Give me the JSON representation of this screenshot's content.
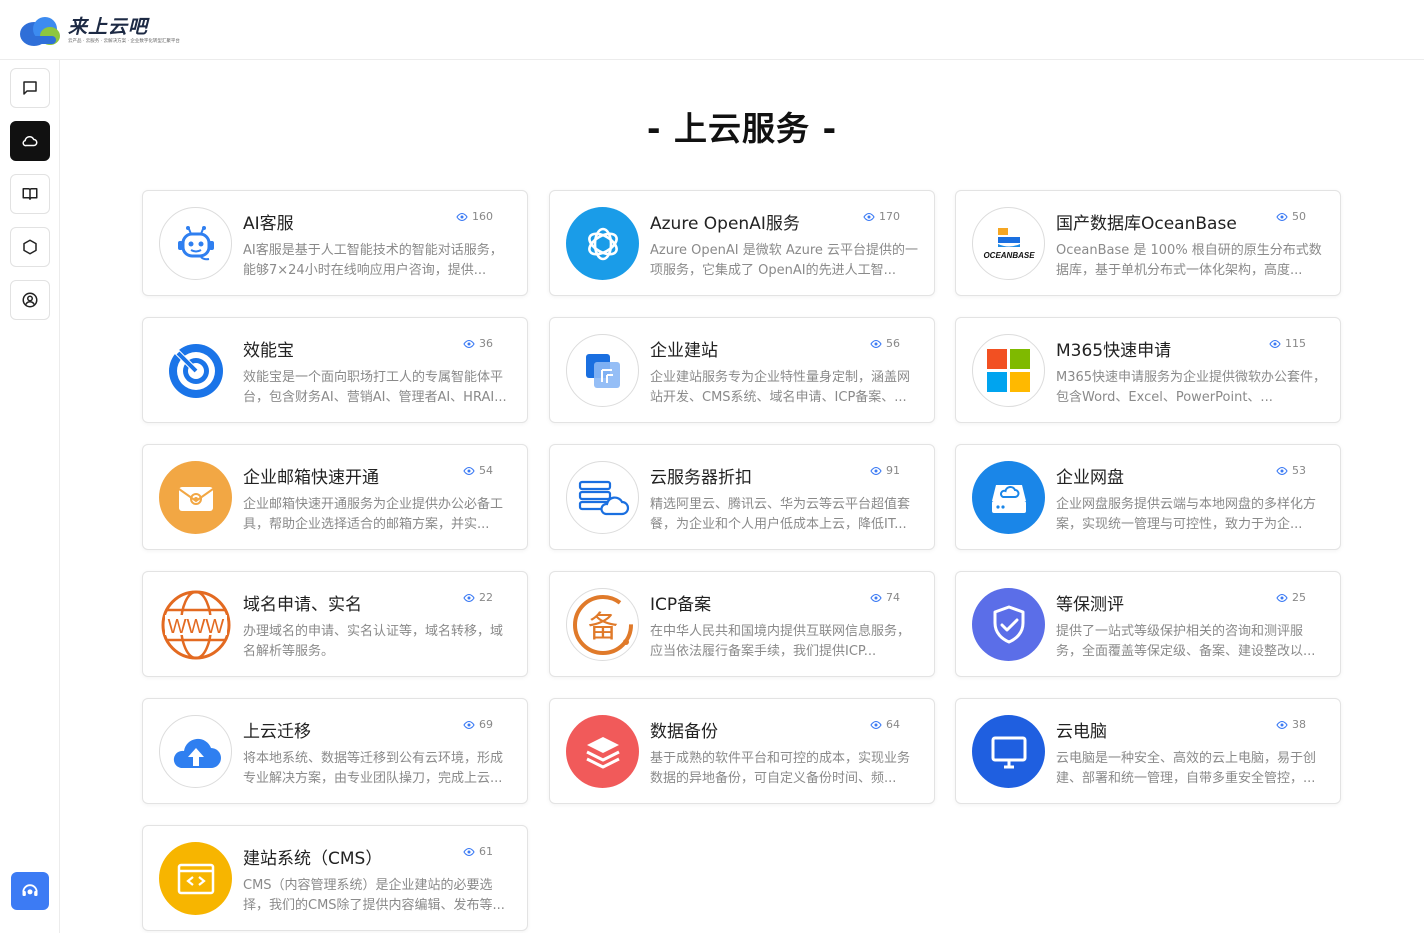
{
  "brand": {
    "title": "来上云吧",
    "subtitle": "云产品 · 云服务 · 云解决方案 · 企业数字化转型汇聚平台",
    "icon": "cloud-logo-icon"
  },
  "sidebar": {
    "items": [
      {
        "icon": "chat-icon",
        "active": false
      },
      {
        "icon": "cloud-icon",
        "active": true
      },
      {
        "icon": "book-icon",
        "active": false
      },
      {
        "icon": "hexagon-icon",
        "active": false
      },
      {
        "icon": "user-circle-icon",
        "active": false
      }
    ],
    "support_icon": "customer-service-icon"
  },
  "page": {
    "title": "- 上云服务 -"
  },
  "colors": {
    "accent": "#3c7bf4",
    "active_nav": "#111111"
  },
  "services": [
    {
      "title": "AI客服",
      "views": "160",
      "desc": "AI客服是基于人工智能技术的智能对话服务，能够7×24小时在线响应用户咨询，提供...",
      "icon": "robot-icon"
    },
    {
      "title": "Azure OpenAI服务",
      "views": "170",
      "desc": "Azure OpenAI 是微软 Azure 云平台提供的一项服务，它集成了 OpenAI的先进人工智...",
      "icon": "openai-icon"
    },
    {
      "title": "国产数据库OceanBase",
      "views": "50",
      "desc": "OceanBase 是 100% 根自研的原生分布式数据库，基于单机分布式一体化架构，高度...",
      "icon": "oceanbase-logo-icon",
      "logo_text": "OCEANBASE"
    },
    {
      "title": "效能宝",
      "views": "36",
      "desc": "效能宝是一个面向职场打工人的专属智能体平台，包含财务AI、营销AI、管理者AI、HRAI...",
      "icon": "gauge-icon"
    },
    {
      "title": "企业建站",
      "views": "56",
      "desc": "企业建站服务专为企业特性量身定制，涵盖网站开发、CMS系统、域名申请、ICP备案、...",
      "icon": "website-builder-icon"
    },
    {
      "title": "M365快速申请",
      "views": "115",
      "desc": "M365快速申请服务为企业提供微软办公套件，包含Word、Excel、PowerPoint、...",
      "icon": "microsoft-logo-icon"
    },
    {
      "title": "企业邮箱快速开通",
      "views": "54",
      "desc": "企业邮箱快速开通服务为企业提供办公必备工具，帮助企业选择适合的邮箱方案，并实...",
      "icon": "email-icon"
    },
    {
      "title": "云服务器折扣",
      "views": "91",
      "desc": "精选阿里云、腾讯云、华为云等云平台超值套餐，为企业和个人用户低成本上云，降低IT...",
      "icon": "cloud-server-icon"
    },
    {
      "title": "企业网盘",
      "views": "53",
      "desc": "企业网盘服务提供云端与本地网盘的多样化方案，实现统一管理与可控性，致力于为企...",
      "icon": "cloud-drive-icon"
    },
    {
      "title": "域名申请、实名",
      "views": "22",
      "desc": "办理域名的申请、实名认证等，域名转移，域名解析等服务。",
      "icon": "www-globe-icon",
      "logo_text": "WWW"
    },
    {
      "title": "ICP备案",
      "views": "74",
      "desc": "在中华人民共和国境内提供互联网信息服务，应当依法履行备案手续，我们提供ICP...",
      "icon": "icp-record-icon",
      "logo_text": "备"
    },
    {
      "title": "等保测评",
      "views": "25",
      "desc": "提供了一站式等级保护相关的咨询和测评服务，全面覆盖等保定级、备案、建设整改以...",
      "icon": "shield-check-icon"
    },
    {
      "title": "上云迁移",
      "views": "69",
      "desc": "将本地系统、数据等迁移到公有云环境，形成专业解决方案，由专业团队操刀，完成上云...",
      "icon": "cloud-upload-icon"
    },
    {
      "title": "数据备份",
      "views": "64",
      "desc": "基于成熟的软件平台和可控的成本，实现业务数据的异地备份，可自定义备份时间、频...",
      "icon": "layers-icon"
    },
    {
      "title": "云电脑",
      "views": "38",
      "desc": "云电脑是一种安全、高效的云上电脑，易于创建、部署和统一管理，自带多重安全管控，...",
      "icon": "monitor-icon"
    },
    {
      "title": "建站系统（CMS）",
      "views": "61",
      "desc": "CMS（内容管理系统）是企业建站的必要选择，我们的CMS除了提供内容编辑、发布等...",
      "icon": "code-window-icon"
    }
  ]
}
